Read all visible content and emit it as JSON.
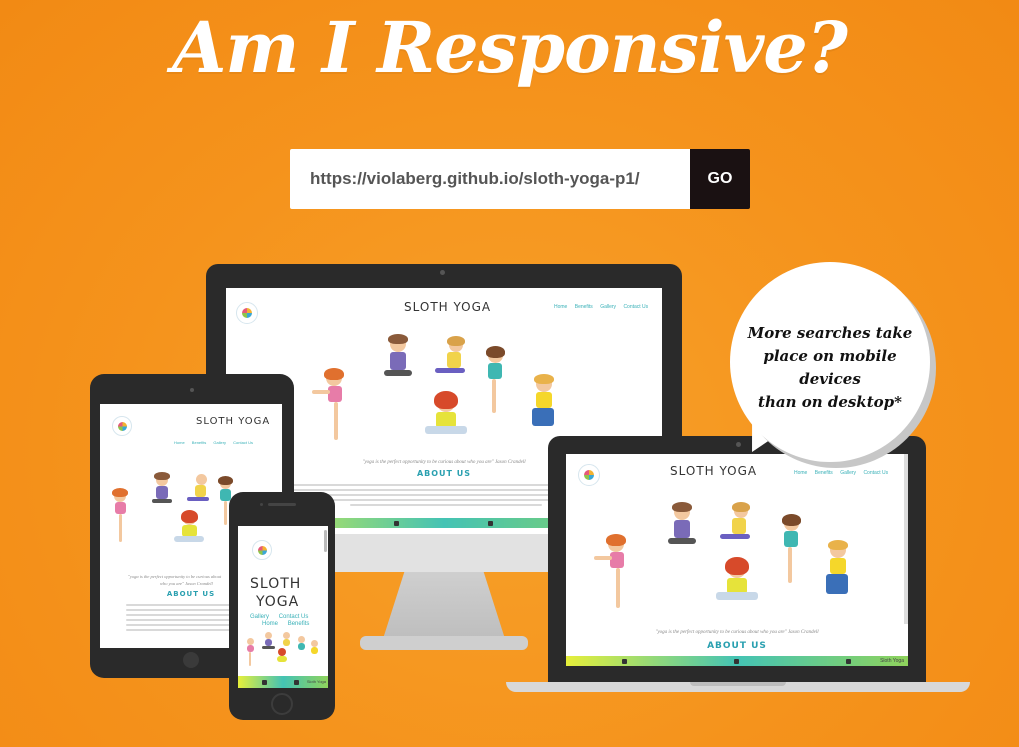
{
  "header": {
    "title": "Am I Responsive?"
  },
  "url_bar": {
    "value": "https://violaberg.github.io/sloth-yoga-p1/",
    "go_label": "GO"
  },
  "bubble": {
    "line1": "More searches take",
    "line2": "place on mobile devices",
    "line3": "than on desktop*"
  },
  "site": {
    "title": "SLOTH YOGA",
    "title_line1": "SLOTH",
    "title_line2": "YOGA",
    "nav": [
      "Home",
      "Benefits",
      "Gallery",
      "Contact Us"
    ],
    "quote": "\"yoga is the perfect opportunity to be curious about who you are\" Jason Crandell",
    "quote_short": "\"yoga is the perfect opportunity to be curious about",
    "quote_short2": "who you are\" Jason Crandell",
    "about": "ABOUT US",
    "footer_text": "Sloth Yoga"
  },
  "colors": {
    "background": "#f5931c",
    "go_button": "#1a1112",
    "device": "#2b2b2b",
    "accent": "#3ab1b8"
  }
}
